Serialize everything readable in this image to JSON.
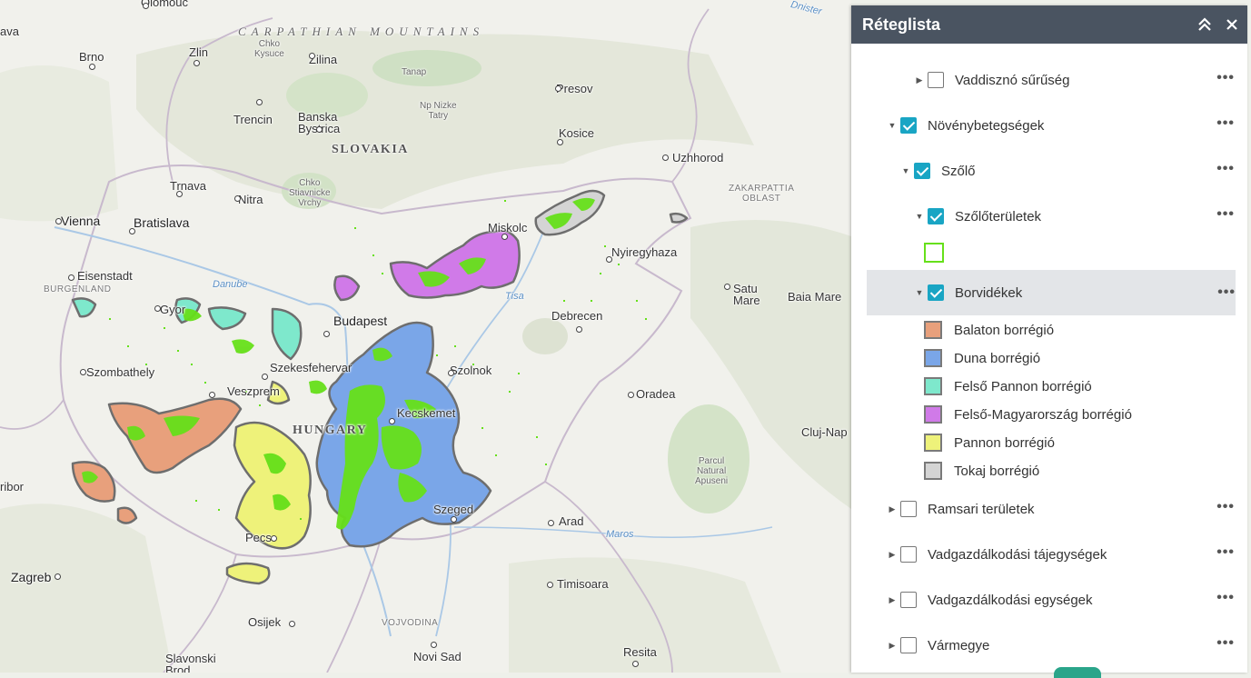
{
  "map": {
    "labels": {
      "olomouc": "Olomouc",
      "ava": "ava",
      "carpathian": "CARPATHIAN MOUNTAINS",
      "brno": "Brno",
      "zlin": "Zlin",
      "chko_kysuce": "Chko\nKysuce",
      "zilina": "Zilina",
      "tanap": "Tanap",
      "presov": "Presov",
      "np_nizke": "Np Nizke\nTatry",
      "trencin": "Trencin",
      "banska": "Banska\nBystrica",
      "kosice": "Kosice",
      "slovakia": "SLOVAKIA",
      "uzhhorod": "Uzhhorod",
      "trnava": "Trnava",
      "nitra": "Nitra",
      "chko_stiav": "Chko\nStiavnicke\nVrchy",
      "zakarpattia": "ZAKARPATTIA\nOBLAST",
      "vienna": "Vienna",
      "bratislava": "Bratislava",
      "miskolc": "Miskolc",
      "nyiregyhaza": "Nyiregyhaza",
      "eisenstadt": "Eisenstadt",
      "burgenland": "BURGENLAND",
      "danube": "Danube",
      "tisa": "Tisa",
      "satu_mare": "Satu\nMare",
      "baia_mare": "Baia Mare",
      "gyor": "Gyor",
      "budapest": "Budapest",
      "debrecen": "Debrecen",
      "szombathely": "Szombathely",
      "szekesfehervar": "Szekesfehervar",
      "szolnok": "Szolnok",
      "veszprem": "Veszprem",
      "oradea": "Oradea",
      "hungary": "HUNGARY",
      "kecskemet": "Kecskemet",
      "cluj": "Cluj-Nap",
      "ribor": "ribor",
      "parcul": "Parcul\nNatural\nApuseni",
      "szeged": "Szeged",
      "arad": "Arad",
      "maros": "Maros",
      "pecs": "Pecs",
      "zagreb": "Zagreb",
      "timisoara": "Timisoara",
      "osijek": "Osijek",
      "vojvodina": "VOJVODINA",
      "novi_sad": "Novi Sad",
      "resita": "Resita",
      "slavonski": "Slavonski\nBrod",
      "nister": "Dnister"
    }
  },
  "panel": {
    "title": "Réteglista",
    "rows": [
      {
        "label": "Vaddisznó sűrűség",
        "checked": false,
        "expanded": false
      },
      {
        "label": "Növénybetegségek",
        "checked": true,
        "expanded": true
      },
      {
        "label": "Szőlő",
        "checked": true,
        "expanded": true
      },
      {
        "label": "Szőlőterületek",
        "checked": true,
        "expanded": true
      },
      {
        "label": "Borvidékek",
        "checked": true,
        "expanded": true,
        "selected": true
      },
      {
        "label": "Ramsari területek",
        "checked": false,
        "expanded": false
      },
      {
        "label": "Vadgazdálkodási tájegységek",
        "checked": false,
        "expanded": false
      },
      {
        "label": "Vadgazdálkodási egységek",
        "checked": false,
        "expanded": false
      },
      {
        "label": "Vármegye",
        "checked": false,
        "expanded": false
      }
    ],
    "more_label": "•••",
    "legend": [
      {
        "label": "Balaton borrégió",
        "color": "#e8a07c"
      },
      {
        "label": "Duna borrégió",
        "color": "#7aa6e8"
      },
      {
        "label": "Felső Pannon borrégió",
        "color": "#7ee8cc"
      },
      {
        "label": "Felső-Magyarország borrégió",
        "color": "#d07ae8"
      },
      {
        "label": "Pannon borrégió",
        "color": "#eef27a"
      },
      {
        "label": "Tokaj borrégió",
        "color": "#d4d4d4"
      }
    ],
    "vineyard_symbol_color": "#66e01a"
  }
}
